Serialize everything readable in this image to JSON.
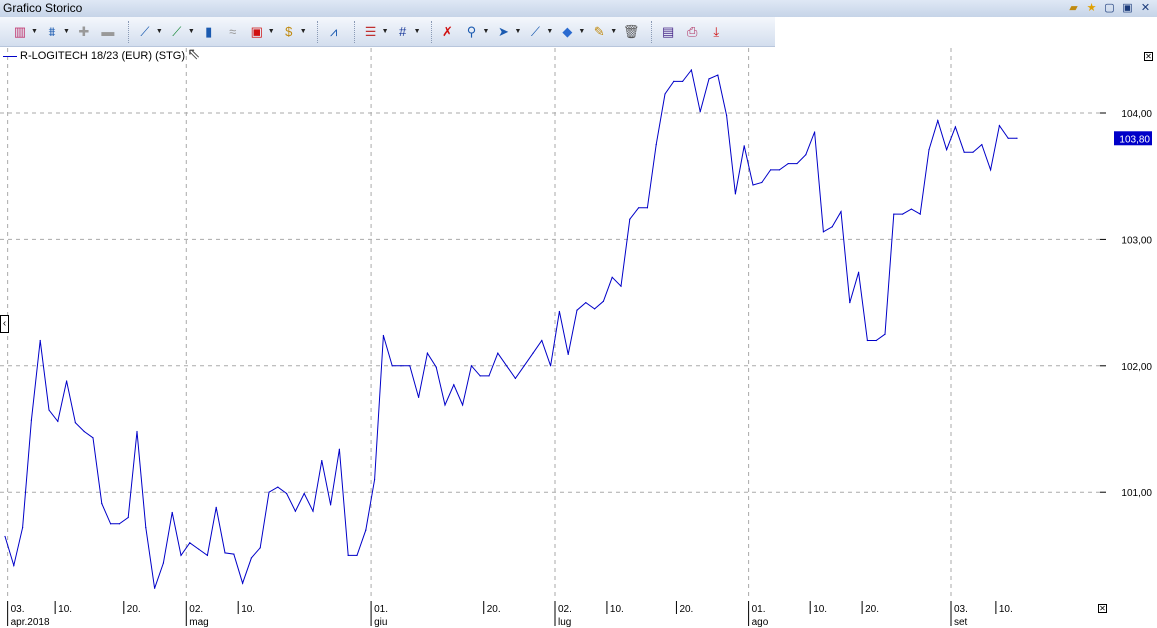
{
  "window": {
    "title": "Grafico Storico"
  },
  "toolbar": [
    {
      "name": "chart-type",
      "glyph": "▥",
      "color": "#c0306a",
      "dd": true
    },
    {
      "name": "indicators",
      "glyph": "⩩",
      "color": "#1a5ab0",
      "dd": true
    },
    {
      "name": "add-study",
      "glyph": "✚",
      "color": "#999",
      "dd": false
    },
    {
      "name": "remove-study",
      "glyph": "▬",
      "color": "#999",
      "dd": false
    },
    {
      "sep": true
    },
    {
      "name": "line-chart",
      "glyph": "⟋",
      "color": "#1a5ab0",
      "dd": true
    },
    {
      "name": "trend",
      "glyph": "⟋",
      "color": "#1a8a3a",
      "dd": true
    },
    {
      "name": "volume",
      "glyph": "▮",
      "color": "#1a5ab0",
      "dd": false
    },
    {
      "name": "compare",
      "glyph": "≈",
      "color": "#999",
      "dd": false
    },
    {
      "name": "candlestick",
      "glyph": "▣",
      "color": "#d01010",
      "dd": true
    },
    {
      "name": "currency",
      "glyph": "$",
      "color": "#c08a10",
      "dd": true
    },
    {
      "sep": true
    },
    {
      "name": "signals",
      "glyph": "⩘",
      "color": "#1a5ab0",
      "dd": false
    },
    {
      "sep": true
    },
    {
      "name": "lines-style",
      "glyph": "☰",
      "color": "#c03030",
      "dd": true
    },
    {
      "name": "grid",
      "glyph": "#",
      "color": "#1a3a9a",
      "dd": true
    },
    {
      "sep": true
    },
    {
      "name": "delete-drawing",
      "glyph": "✗",
      "color": "#d01010",
      "dd": false
    },
    {
      "name": "zoom",
      "glyph": "⚲",
      "color": "#1a5ab0",
      "dd": true
    },
    {
      "name": "pointer",
      "glyph": "➤",
      "color": "#1a5ab0",
      "dd": true
    },
    {
      "name": "draw-line",
      "glyph": "⟋",
      "color": "#1a5ab0",
      "dd": true
    },
    {
      "name": "fill",
      "glyph": "◆",
      "color": "#2a6ad0",
      "dd": true
    },
    {
      "name": "notes",
      "glyph": "✎",
      "color": "#c08a10",
      "dd": true
    },
    {
      "name": "trash",
      "glyph": "🗑",
      "color": "#555",
      "dd": false
    },
    {
      "sep": true
    },
    {
      "name": "clipboard",
      "glyph": "▤",
      "color": "#4a2a8a",
      "dd": false
    },
    {
      "name": "print",
      "glyph": "⎙",
      "color": "#b03060",
      "dd": false
    },
    {
      "name": "export",
      "glyph": "⤓",
      "color": "#d01010",
      "dd": false
    }
  ],
  "legend": {
    "label": "R-LOGITECH 18/23 (EUR) (STG)"
  },
  "chart_data": {
    "type": "line",
    "series": [
      {
        "name": "R-LOGITECH 18/23 (EUR) (STG)",
        "color": "#0000c8",
        "values": [
          100.65,
          100.42,
          100.72,
          101.57,
          102.2,
          101.65,
          101.56,
          101.88,
          101.55,
          101.48,
          101.43,
          100.91,
          100.75,
          100.75,
          100.8,
          101.48,
          100.72,
          100.24,
          100.44,
          100.84,
          100.5,
          100.6,
          100.55,
          100.5,
          100.88,
          100.52,
          100.51,
          100.28,
          100.48,
          100.56,
          101.0,
          101.04,
          100.99,
          100.85,
          100.99,
          100.85,
          101.25,
          100.9,
          101.34,
          100.5,
          100.5,
          100.7,
          101.1,
          102.24,
          102.0,
          102.0,
          102.0,
          101.75,
          102.1,
          101.99,
          101.69,
          101.85,
          101.69,
          102.0,
          101.92,
          101.92,
          102.1,
          102.0,
          101.9,
          102.0,
          102.1,
          102.2,
          102.0,
          102.43,
          102.09,
          102.44,
          102.5,
          102.45,
          102.51,
          102.7,
          102.63,
          103.16,
          103.25,
          103.25,
          103.75,
          104.15,
          104.25,
          104.25,
          104.34,
          104.01,
          104.27,
          104.3,
          103.98,
          103.36,
          103.74,
          103.43,
          103.45,
          103.55,
          103.55,
          103.6,
          103.6,
          103.67,
          103.85,
          103.06,
          103.1,
          103.22,
          102.5,
          102.74,
          102.2,
          102.2,
          102.25,
          103.2,
          103.2,
          103.24,
          103.2,
          103.71,
          103.94,
          103.71,
          103.89,
          103.69,
          103.69,
          103.75,
          103.55,
          103.9,
          103.8,
          103.8
        ]
      }
    ],
    "last_value": "103,80",
    "ylim": [
      99.6,
      104.45
    ],
    "yticks": [
      {
        "v": 104,
        "label": "104,00"
      },
      {
        "v": 103,
        "label": "103,00"
      },
      {
        "v": 102,
        "label": "102,00"
      },
      {
        "v": 101,
        "label": "101,00"
      }
    ],
    "xticks": [
      {
        "at": 0.3,
        "label": "03.",
        "sub": "apr.2018",
        "month": true
      },
      {
        "at": 5.7,
        "label": "10."
      },
      {
        "at": 13.5,
        "label": "20."
      },
      {
        "at": 20.6,
        "label": "02.",
        "sub": "mag",
        "month": true
      },
      {
        "at": 26.5,
        "label": "10."
      },
      {
        "at": 41.6,
        "label": "01.",
        "sub": "giu",
        "month": true
      },
      {
        "at": 54.4,
        "label": "20."
      },
      {
        "at": 62.5,
        "label": "02.",
        "sub": "lug",
        "month": true
      },
      {
        "at": 68.4,
        "label": "10."
      },
      {
        "at": 76.3,
        "label": "20."
      },
      {
        "at": 84.5,
        "label": "01.",
        "sub": "ago",
        "month": true
      },
      {
        "at": 91.5,
        "label": "10."
      },
      {
        "at": 97.4,
        "label": "20."
      },
      {
        "at": 107.5,
        "label": "03.",
        "sub": "set",
        "month": true
      },
      {
        "at": 112.6,
        "label": "10."
      }
    ],
    "grid": true
  },
  "colors": {
    "line": "#0000c8",
    "badge": "#0000c8"
  }
}
